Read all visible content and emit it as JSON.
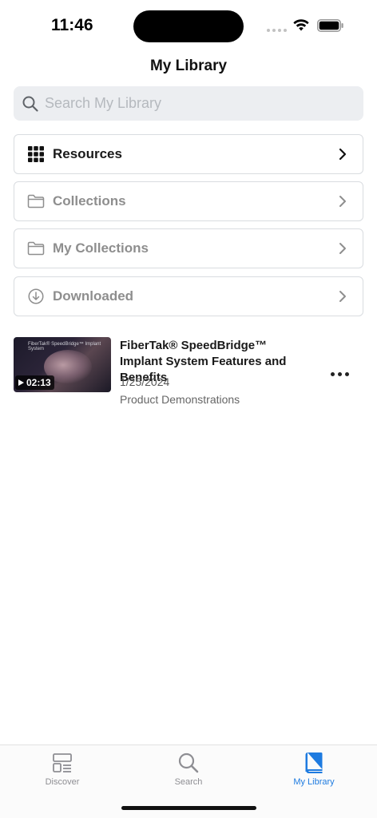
{
  "status_bar": {
    "time": "11:46"
  },
  "nav": {
    "title": "My Library"
  },
  "search": {
    "placeholder": "Search My Library"
  },
  "menu": [
    {
      "label": "Resources",
      "icon": "grid-icon"
    },
    {
      "label": "Collections",
      "icon": "folder-icon"
    },
    {
      "label": "My Collections",
      "icon": "folder-icon"
    },
    {
      "label": "Downloaded",
      "icon": "download-circle-icon"
    }
  ],
  "items": [
    {
      "title": "FiberTak® SpeedBridge™ Implant System Features and Benefits",
      "thumbnail_text": "FiberTak® SpeedBridge™ Implant System",
      "duration": "02:13",
      "date": "1/25/2024",
      "category": "Product Demonstrations"
    }
  ],
  "tabs": [
    {
      "label": "Discover",
      "icon": "discover-icon"
    },
    {
      "label": "Search",
      "icon": "search-icon"
    },
    {
      "label": "My Library",
      "icon": "book-icon",
      "active": true
    }
  ],
  "colors": {
    "accent": "#1e7be0",
    "inactive": "#8e8e93"
  }
}
